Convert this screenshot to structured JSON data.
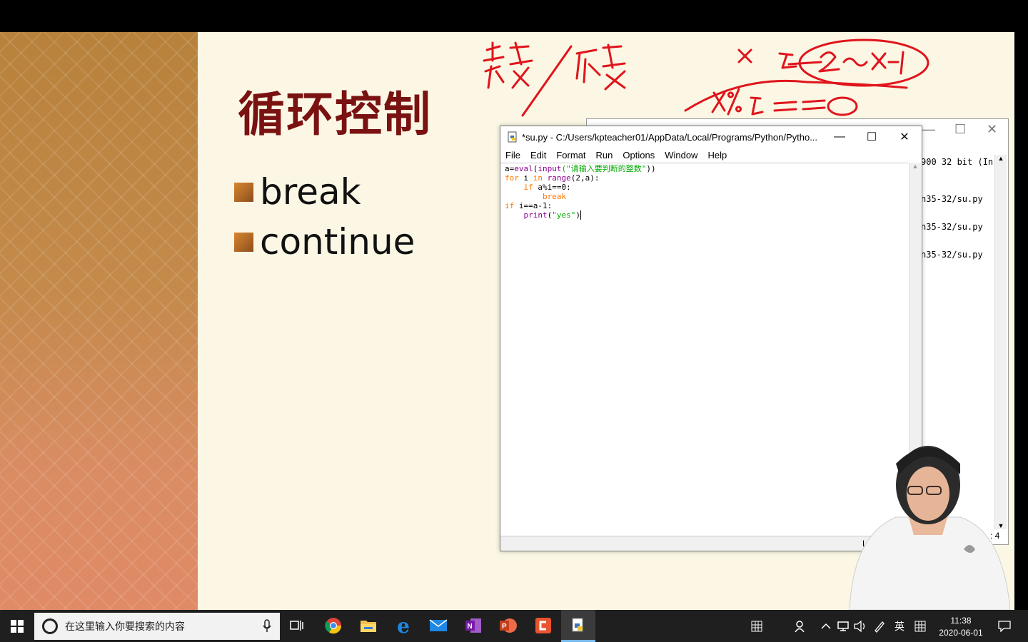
{
  "slide": {
    "title": "循环控制",
    "bullets": [
      "break",
      "continue"
    ],
    "annotations": {
      "left_words": "素数 / 质数",
      "right_words": "x  i  2~x-1",
      "equation": "x%i==0"
    }
  },
  "editor": {
    "title": "*su.py - C:/Users/kpteacher01/AppData/Local/Programs/Python/Pytho...",
    "menu": [
      "File",
      "Edit",
      "Format",
      "Run",
      "Options",
      "Window",
      "Help"
    ],
    "code": {
      "line1_var": "a=",
      "line1_eval": "eval",
      "line1_open": "(",
      "line1_input": "input",
      "line1_str": "(\"请输入要判断的整数\"",
      "line1_close": "))",
      "line2_for": "for",
      "line2_i": " i ",
      "line2_in": "in",
      "line2_range": " range",
      "line2_args": "(2,a):",
      "line3_if": "    if",
      "line3_cond": " a%i==0:",
      "line4_break": "        break",
      "line5_if": "if",
      "line5_cond": " i==a-1:",
      "line6_print": "    print",
      "line6_open": "(",
      "line6_str": "\"yes\"",
      "line6_close": ")"
    },
    "status": "L"
  },
  "shell": {
    "lines": [
      "900 32 bit (In",
      "n35-32/su.py",
      "n35-32/su.py",
      "n35-32/su.py"
    ],
    "status": ": 4"
  },
  "taskbar": {
    "search_placeholder": "在这里输入你要搜索的内容",
    "ime": "英",
    "time": "11:38",
    "date": "2020-06-01"
  }
}
